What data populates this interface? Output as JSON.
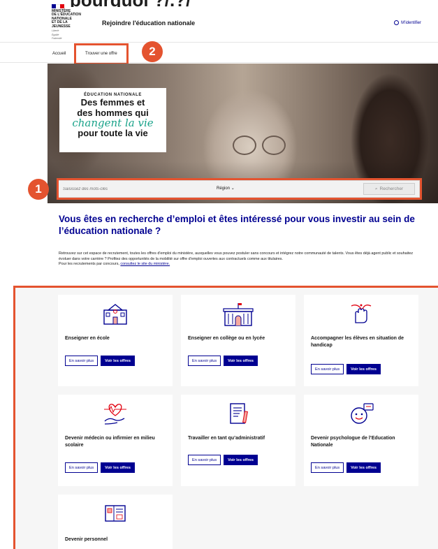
{
  "top_heading": "pourquoi ?/.?/",
  "header": {
    "ministry_lines": [
      "Ministère",
      "de l'Éducation",
      "nationale",
      "et de la Jeunesse"
    ],
    "motto_lines": [
      "Liberté",
      "Égalité",
      "Fraternité"
    ],
    "site_title": "Rejoindre l'éducation nationale",
    "login_label": "M'identifier",
    "flag_colors": [
      "#000091",
      "#ffffff",
      "#e1000f"
    ]
  },
  "nav": {
    "home_label": "Accueil",
    "offer_label": "Trouver une offre"
  },
  "annotations": {
    "badge_1": "1",
    "badge_2": "2",
    "highlight_color": "#e4532f"
  },
  "hero": {
    "overline": "ÉDUCATION NATIONALE",
    "line1": "Des femmes et",
    "line2": "des hommes qui",
    "script": "changent la vie",
    "line4": "pour toute la vie"
  },
  "search": {
    "placeholder": "Saisissez des mots-clés",
    "region_label": "Région",
    "button_label": "Rechercher"
  },
  "intro": {
    "title": "Vous êtes en recherche d’emploi et êtes intéressé pour vous investir au sein de l’éducation nationale ?",
    "paragraph1": "Retrouvez sur cet espace de recrutement, toutes les offres d'emploi du ministère, auxquelles vous pouvez postuler sans concours et intégrez notre communauté de talents. Vous êtes déjà agent public et souhaitez évoluer dans votre carrière ? Profitez des opportunités de la mobilité sur offre d'emploi ouvertes aux contractuels comme aux titulaires.",
    "paragraph2_prefix": "Pour les recrutements par concours,",
    "paragraph2_link": "consultez le site du ministère."
  },
  "cards": [
    {
      "title": "Enseigner en école",
      "icon": "school-building-icon",
      "more_label": "En savoir plus",
      "offers_label": "Voir les offres"
    },
    {
      "title": "Enseigner en collège ou en lycée",
      "icon": "high-school-building-icon",
      "more_label": "En savoir plus",
      "offers_label": "Voir les offres"
    },
    {
      "title": "Accompagner les élèves en situation de handicap",
      "icon": "support-hand-icon",
      "more_label": "En savoir plus",
      "offers_label": "Voir les offres"
    },
    {
      "title": "Devenir médecin ou infirmier en milieu scolaire",
      "icon": "health-heart-icon",
      "more_label": "En savoir plus",
      "offers_label": "Voir les offres"
    },
    {
      "title": "Travailler en tant qu’administratif",
      "icon": "document-pen-icon",
      "more_label": "En savoir plus",
      "offers_label": "Voir les offres"
    },
    {
      "title": "Devenir psychologue de l’Education Nationale",
      "icon": "speech-bubbles-icon",
      "more_label": "En savoir plus",
      "offers_label": "Voir les offres"
    },
    {
      "title": "Devenir personnel",
      "icon": "presentation-board-icon"
    }
  ]
}
